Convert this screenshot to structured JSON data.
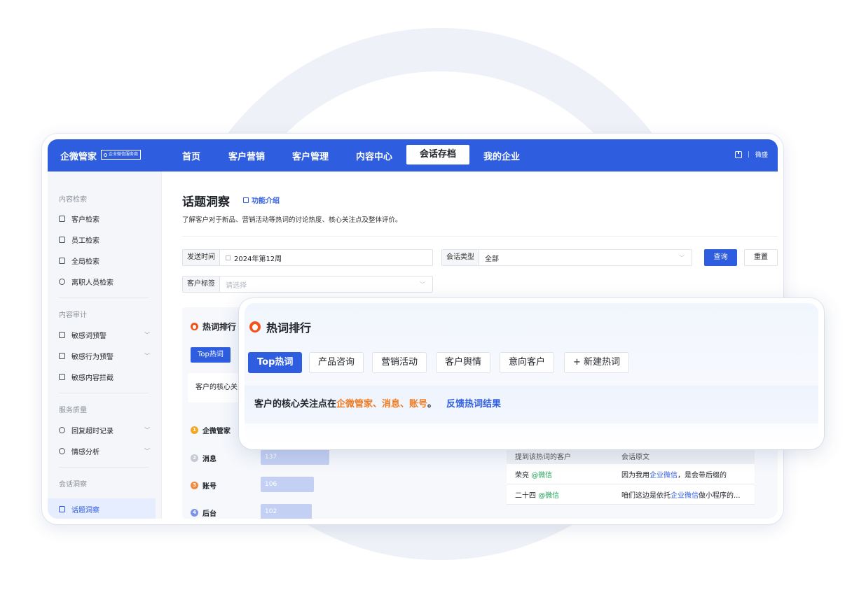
{
  "nav": {
    "brand": "企微管家",
    "brand_badge": "企业微信服务商",
    "items": [
      "首页",
      "客户营销",
      "客户管理",
      "内容中心",
      "会话存档",
      "我的企业"
    ],
    "active": "会话存档",
    "user": "微盛"
  },
  "sidebar": {
    "group1": "内容检索",
    "g1_items": [
      "客户检索",
      "员工检索",
      "全局检索",
      "离职人员检索"
    ],
    "group2": "内容审计",
    "g2_items": [
      "敏感词预警",
      "敏感行为预警",
      "敏感内容拦截"
    ],
    "group3": "服务质量",
    "g3_items": [
      "回复超时记录",
      "情感分析"
    ],
    "group4": "会话洞察",
    "g4_items": [
      "话题洞察"
    ]
  },
  "page": {
    "title": "话题洞察",
    "feature_link": "功能介绍",
    "desc": "了解客户对于新品、营销活动等热词的讨论热度、核心关注点及整体评价。"
  },
  "filters": {
    "send_time_label": "发送时间",
    "send_time_value": "2024年第12周",
    "session_type_label": "会话类型",
    "session_type_value": "全部",
    "customer_tag_label": "客户标签",
    "customer_tag_placeholder": "请选择",
    "query_button": "查询",
    "reset_button": "重置"
  },
  "background_card": {
    "title": "热词排行",
    "top_tab": "Top热词",
    "focus_partial": "客户的核心关",
    "ranking": [
      {
        "rank": "1",
        "word": "企微管家",
        "count": null,
        "color": "#f5a623"
      },
      {
        "rank": "2",
        "word": "消息",
        "count": 137,
        "color": "#c4c9d4"
      },
      {
        "rank": "3",
        "word": "账号",
        "count": 106,
        "color": "#f08a3c"
      },
      {
        "rank": "4",
        "word": "后台",
        "count": 102,
        "color": "#7c95e8"
      }
    ],
    "table": {
      "headers": [
        "提到该热词的客户",
        "会话原文"
      ],
      "rows": [
        {
          "name": "荣亮",
          "channel": "@微信",
          "pre": "因为我用",
          "hl": "企业微信",
          "post": "，是会带后缀的"
        },
        {
          "name": "二十四",
          "channel": "@微信",
          "pre": "咱们这边是依托",
          "hl": "企业微信",
          "post": "做小程序的..."
        }
      ]
    }
  },
  "popup": {
    "title": "热词排行",
    "tabs": [
      "Top热词",
      "产品咨询",
      "营销活动",
      "客户舆情",
      "意向客户",
      "+ 新建热词"
    ],
    "focus_prefix": "客户的核心关注点在",
    "focus_words": "企微管家、消息、账号",
    "focus_end": "。",
    "feedback_link": "反馈热词结果"
  }
}
